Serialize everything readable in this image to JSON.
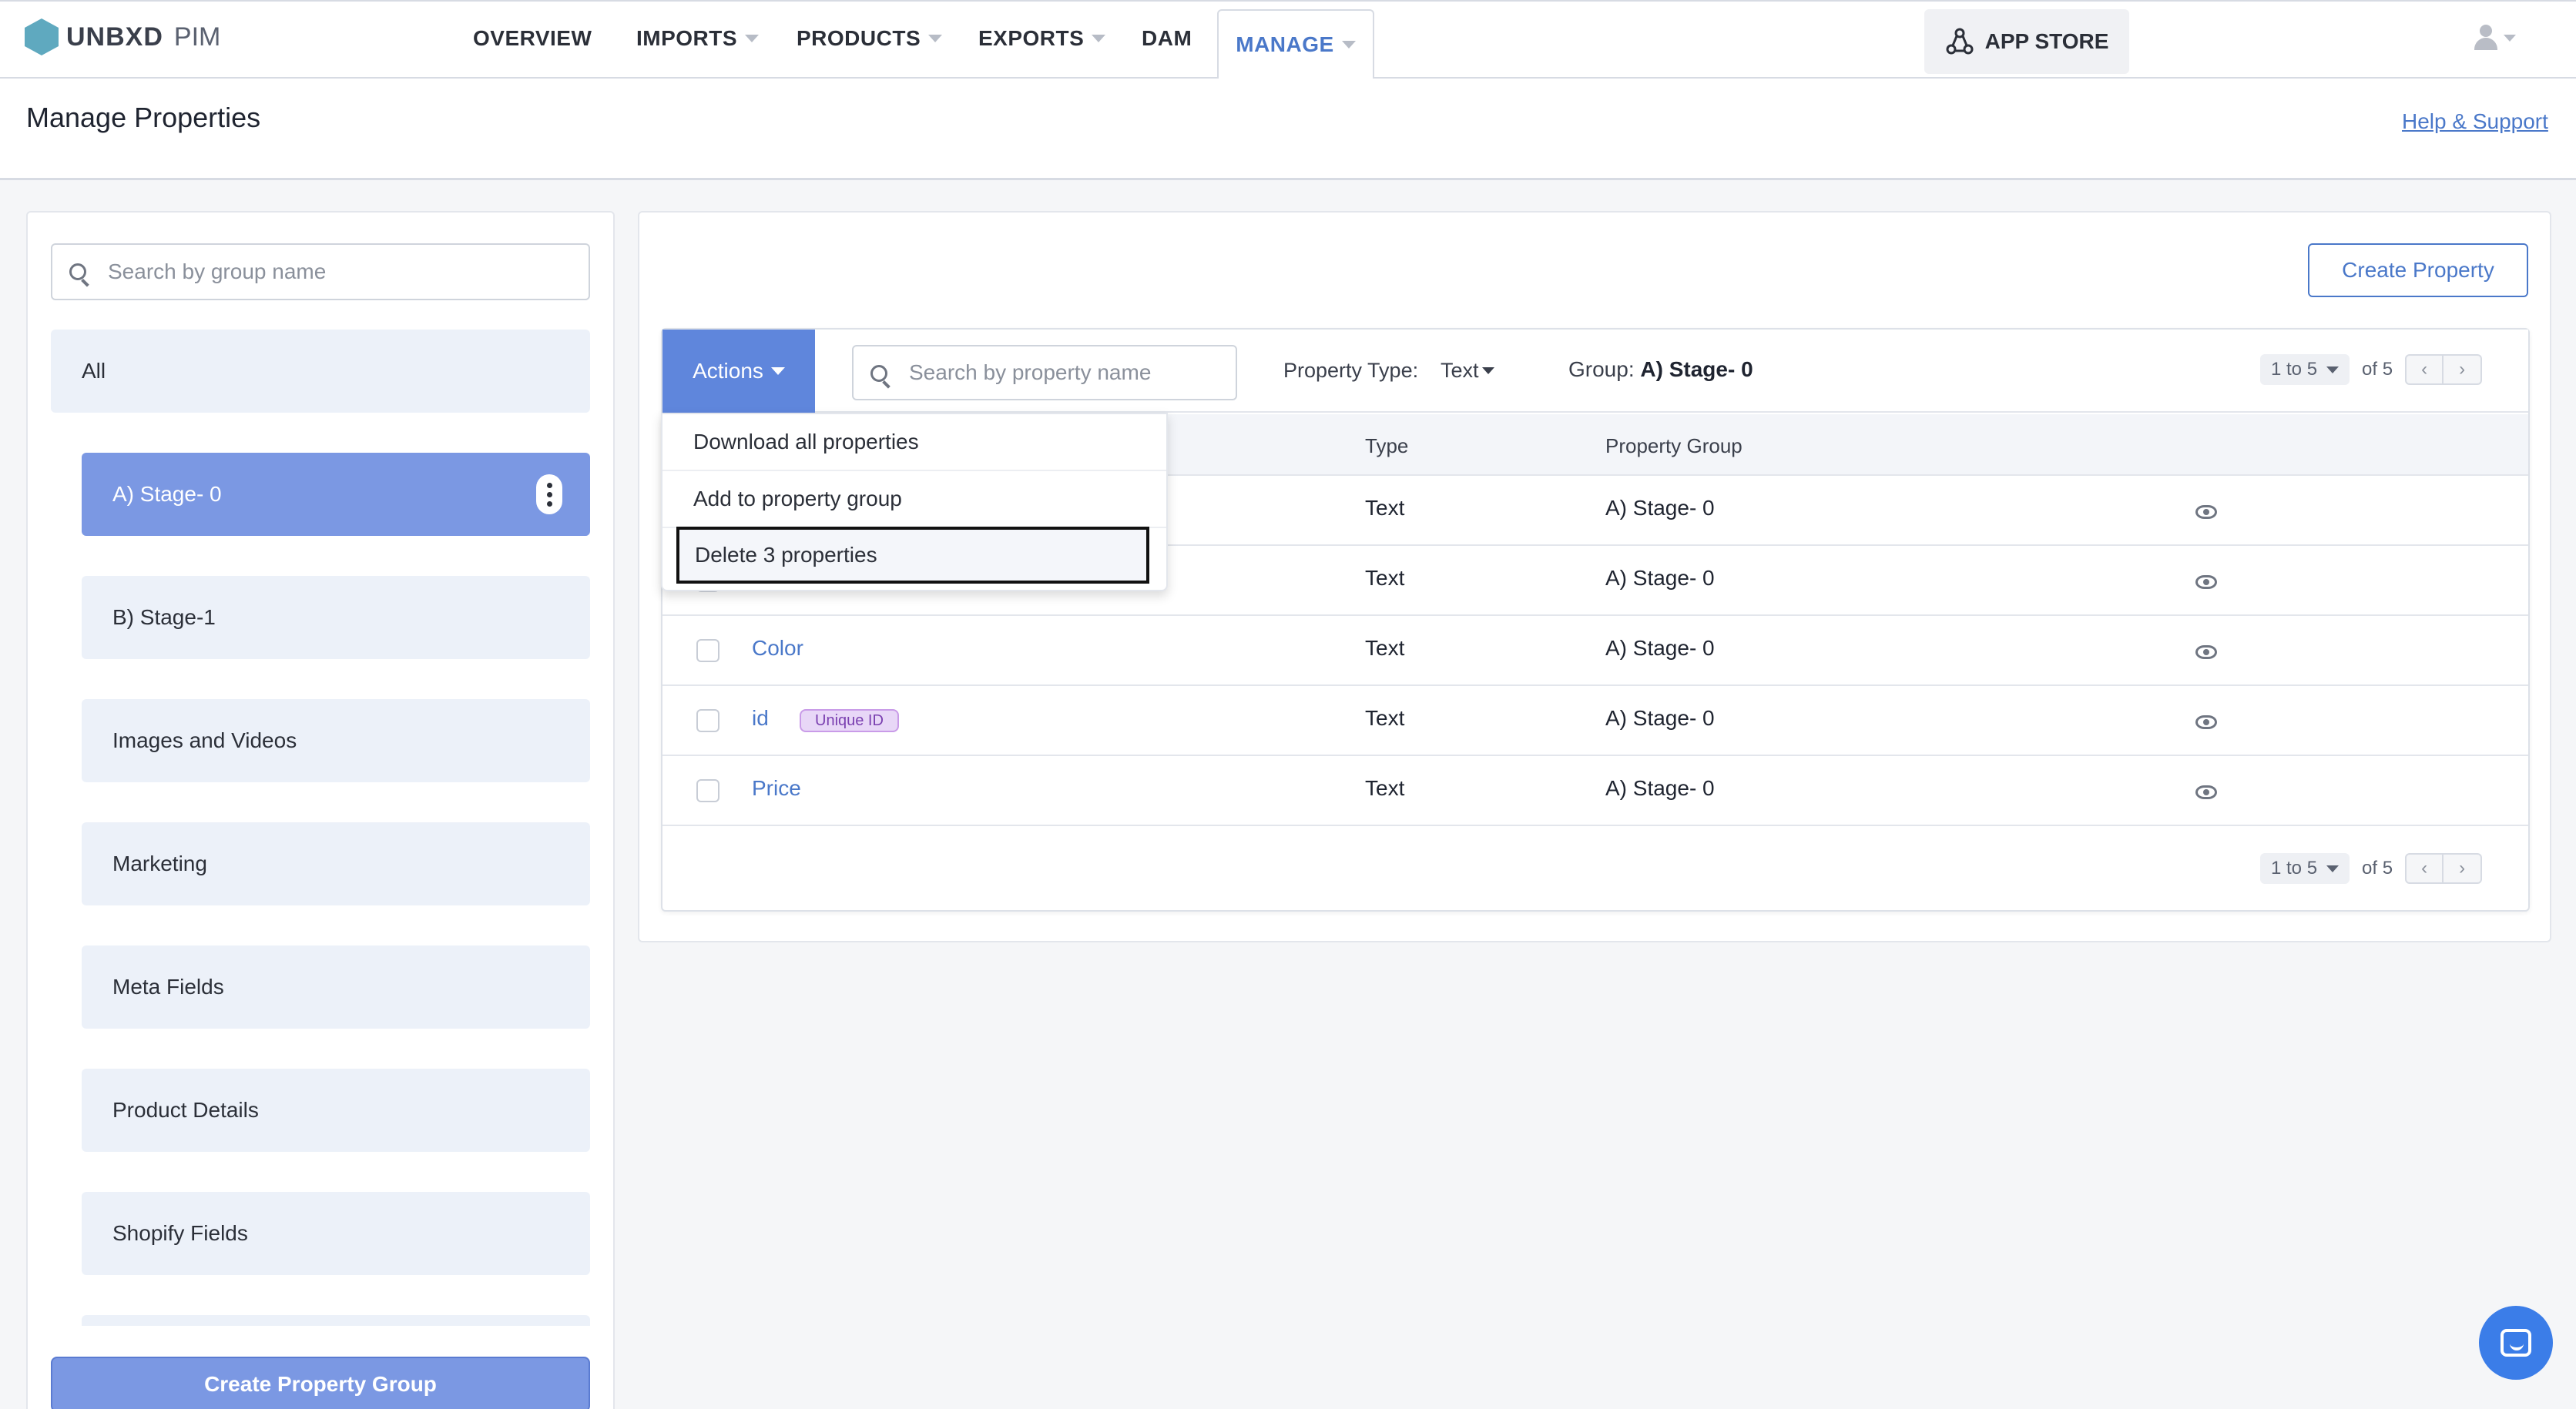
{
  "app": {
    "brand": "UNBXD",
    "product": "PIM"
  },
  "nav": {
    "items": [
      {
        "label": "OVERVIEW",
        "has_caret": false
      },
      {
        "label": "IMPORTS",
        "has_caret": true
      },
      {
        "label": "PRODUCTS",
        "has_caret": true
      },
      {
        "label": "EXPORTS",
        "has_caret": true
      },
      {
        "label": "DAM",
        "has_caret": false
      },
      {
        "label": "MANAGE",
        "has_caret": true,
        "active": true
      }
    ],
    "app_store": "APP STORE"
  },
  "header": {
    "title": "Manage Properties",
    "help_link": "Help & Support"
  },
  "groups": {
    "search_placeholder": "Search by group name",
    "all_label": "All",
    "items": [
      "A) Stage- 0",
      "B) Stage-1",
      "Images and Videos",
      "Marketing",
      "Meta Fields",
      "Product Details",
      "Shopify Fields"
    ],
    "selected": "A) Stage- 0",
    "create_button": "Create Property Group"
  },
  "properties": {
    "create_button": "Create Property",
    "actions_label": "Actions",
    "search_placeholder": "Search by property name",
    "type_filter_label": "Property Type:",
    "type_filter_value": "Text",
    "group_filter_label": "Group:",
    "group_filter_value": "A) Stage- 0",
    "pager": {
      "range": "1 to 5",
      "total": "of 5"
    },
    "columns": {
      "type": "Type",
      "group": "Property Group"
    },
    "rows": [
      {
        "name": "",
        "type": "Text",
        "group": "A) Stage- 0",
        "badge": ""
      },
      {
        "name": "",
        "type": "Text",
        "group": "A) Stage- 0",
        "badge": ""
      },
      {
        "name": "Color",
        "type": "Text",
        "group": "A) Stage- 0",
        "badge": ""
      },
      {
        "name": "id",
        "type": "Text",
        "group": "A) Stage- 0",
        "badge": "Unique ID"
      },
      {
        "name": "Price",
        "type": "Text",
        "group": "A) Stage- 0",
        "badge": ""
      }
    ]
  },
  "actions_menu": {
    "items": [
      "Download all properties",
      "Add to property group",
      "Delete 3 properties"
    ],
    "highlighted": "Delete 3 properties"
  },
  "colors": {
    "accent": "#4a78c9",
    "selected_group": "#7b98e3",
    "actions_button": "#5f86dc",
    "badge": "#e8d7f7",
    "chat": "#3b7de8"
  },
  "icons": [
    "search-icon",
    "kebab-menu-icon",
    "eye-icon",
    "app-store-icon",
    "user-icon",
    "chat-icon",
    "caret-down-icon",
    "chevron-left-icon",
    "chevron-right-icon"
  ]
}
